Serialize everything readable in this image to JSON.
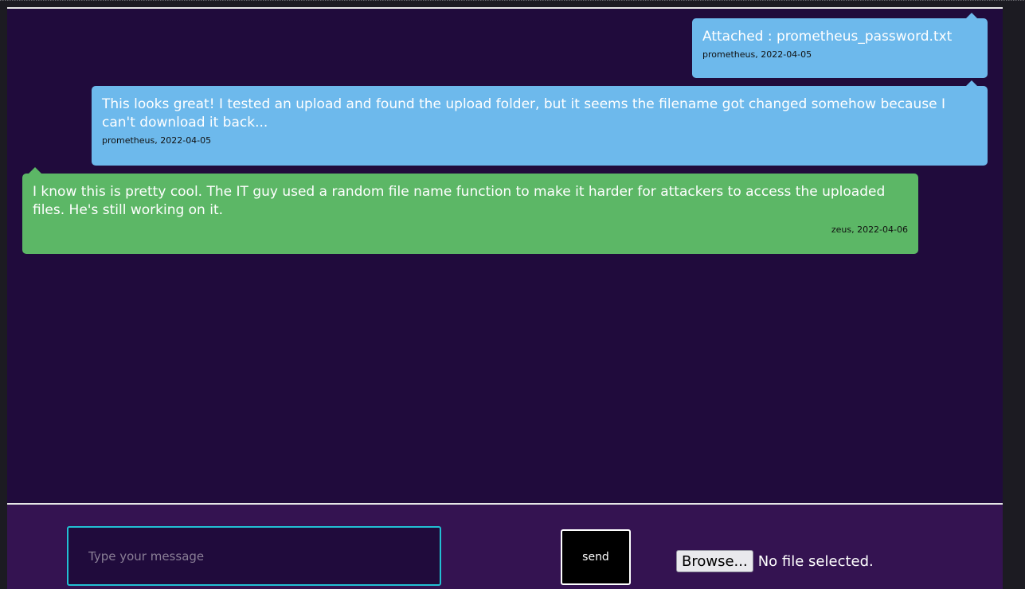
{
  "messages": [
    {
      "text": "Attached : prometheus_password.txt",
      "meta": "prometheus, 2022-04-05",
      "color": "#6db9ec",
      "side": "right"
    },
    {
      "text": "This looks great! I tested an upload and found the upload folder, but it seems the filename got changed somehow because I can't download it back...",
      "meta": "prometheus, 2022-04-05",
      "color": "#6db9ec",
      "side": "right"
    },
    {
      "text": "I know this is pretty cool. The IT guy used a random file name function to make it harder for attackers to access the uploaded files. He's still working on it.",
      "meta": "zeus, 2022-04-06",
      "color": "#5cb766",
      "side": "left"
    }
  ],
  "composer": {
    "placeholder": "Type your message",
    "send_label": "send",
    "browse_label": "Browse...",
    "file_status": "No file selected."
  },
  "colors": {
    "chat_bg": "#200b3c",
    "input_bg": "#341351",
    "input_border": "#22c0d3"
  }
}
